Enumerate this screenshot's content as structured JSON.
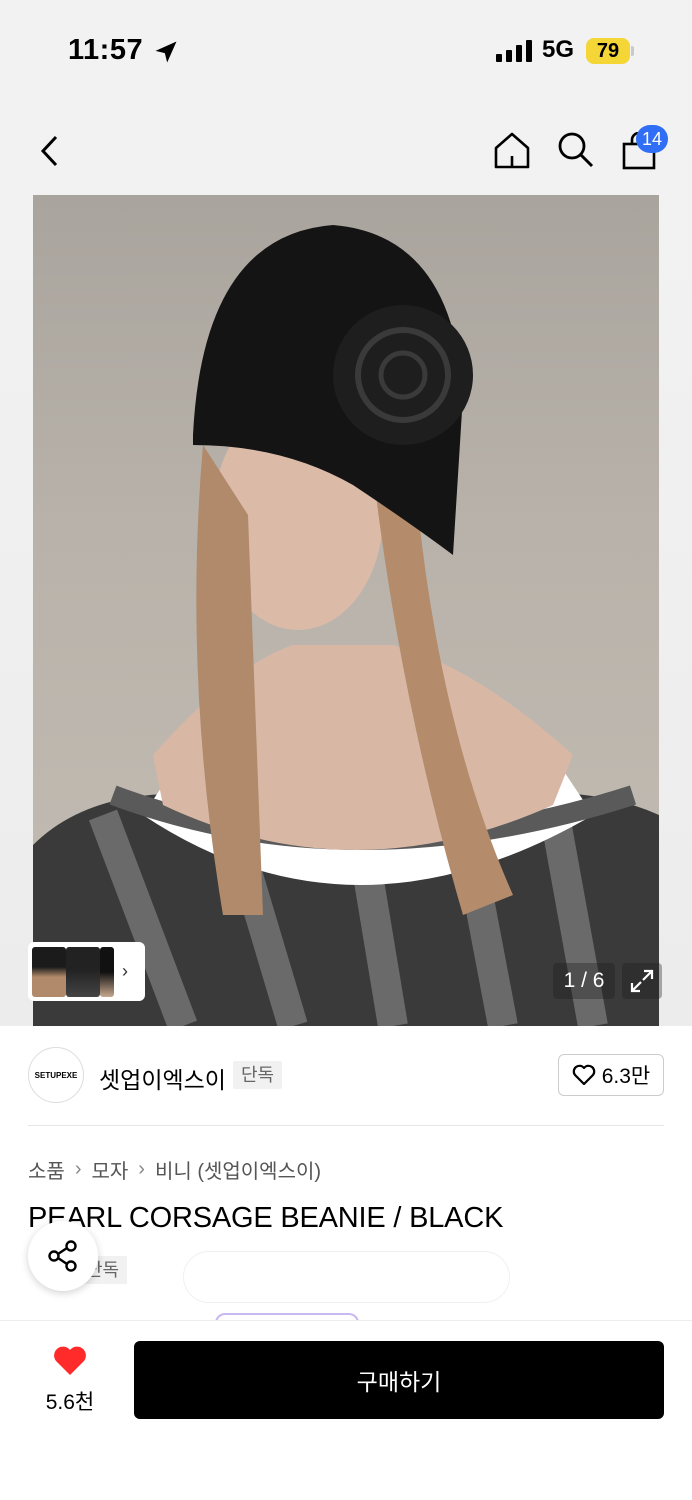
{
  "status_bar": {
    "time": "11:57",
    "network": "5G",
    "battery": "79"
  },
  "nav": {
    "cart_count": "14"
  },
  "gallery": {
    "counter": "1 / 6"
  },
  "brand": {
    "logo_text": "SETUPEXE",
    "name": "셋업이엑스이",
    "tag": "단독",
    "likes": "6.3만"
  },
  "breadcrumb": [
    "소품",
    "모자",
    "비니 (셋업이엑스이)"
  ],
  "product": {
    "title": "PEARL CORSAGE BEANIE / BLACK",
    "exclusive_tag": "단독"
  },
  "bottom": {
    "fav_count": "5.6천",
    "buy_label": "구매하기"
  },
  "colors": {
    "accent_badge": "#2f6ef5",
    "battery": "#f5d637",
    "heart": "#ff2a2a",
    "buy_button": "#000000"
  }
}
